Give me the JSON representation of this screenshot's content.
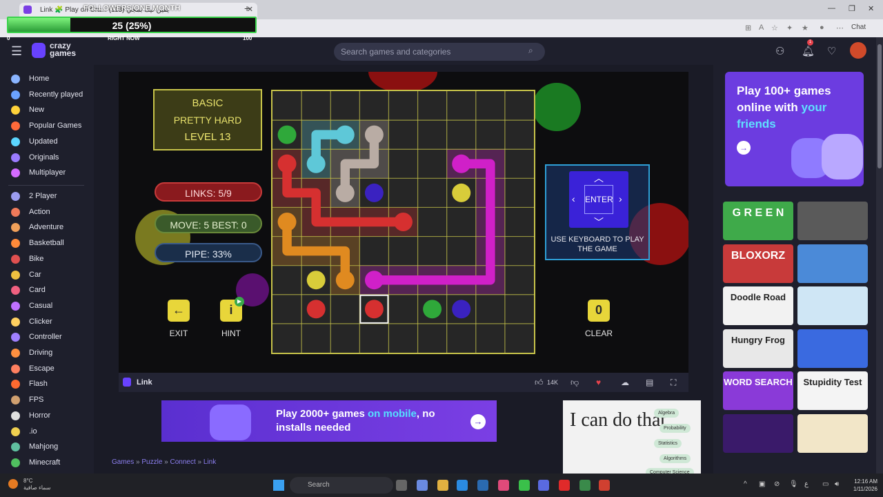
{
  "browser": {
    "tab_title": "Link 🧩 Play on Cra... (113) يقين ليك بمجي",
    "new_tab": "+",
    "chat_label": "Chat"
  },
  "overlay": {
    "title": "FOLLOWERS/ONE MONTH",
    "progress_text": "25 (25%)",
    "progress_fraction": 0.25,
    "min_label": "0",
    "mid_label": "RIGHT NOW",
    "max_label": "100"
  },
  "header": {
    "logo_text": "crazy games",
    "search_placeholder": "Search games and categories",
    "notification_count": "1"
  },
  "sidebar": {
    "primary": [
      {
        "label": "Home",
        "color": "#8ab4ff"
      },
      {
        "label": "Recently played",
        "color": "#6aa2ff"
      },
      {
        "label": "New",
        "color": "#ffd23a"
      },
      {
        "label": "Popular Games",
        "color": "#ff6a3a"
      },
      {
        "label": "Updated",
        "color": "#5bd6ff"
      },
      {
        "label": "Originals",
        "color": "#9b7bff"
      },
      {
        "label": "Multiplayer",
        "color": "#d46bff"
      }
    ],
    "categories": [
      {
        "label": "2 Player",
        "color": "#9b9cf0"
      },
      {
        "label": "Action",
        "color": "#f07a5a"
      },
      {
        "label": "Adventure",
        "color": "#f0a05a"
      },
      {
        "label": "Basketball",
        "color": "#ff8a3a"
      },
      {
        "label": "Bike",
        "color": "#e05050"
      },
      {
        "label": "Car",
        "color": "#f0c040"
      },
      {
        "label": "Card",
        "color": "#f06080"
      },
      {
        "label": "Casual",
        "color": "#c070ff"
      },
      {
        "label": "Clicker",
        "color": "#ffd060"
      },
      {
        "label": "Controller",
        "color": "#a080ff"
      },
      {
        "label": "Driving",
        "color": "#ff9040"
      },
      {
        "label": "Escape",
        "color": "#ff8060"
      },
      {
        "label": "Flash",
        "color": "#ff6a30"
      },
      {
        "label": "FPS",
        "color": "#d0a070"
      },
      {
        "label": "Horror",
        "color": "#e0e0e0"
      },
      {
        "label": ".io",
        "color": "#f0d050"
      },
      {
        "label": "Mahjong",
        "color": "#60c0a0"
      },
      {
        "label": "Minecraft",
        "color": "#50c060"
      }
    ]
  },
  "game": {
    "difficulty": "BASIC",
    "mode": "PRETTY HARD",
    "level": "LEVEL  13",
    "links": "LINKS:  5/9",
    "moves": "MOVE: 5    BEST: 0",
    "pipe": "PIPE:  33%",
    "exit_label": "EXIT",
    "hint_label": "HINT",
    "clear_label": "CLEAR",
    "clear_count": "0",
    "enter_label": "ENTER",
    "keyboard_text": "USE KEYBOARD TO PLAY THE GAME",
    "grid_size": 9,
    "colors": {
      "red": "#d63030",
      "green": "#2fa83a",
      "cyan": "#5ec8d8",
      "gray": "#b9aca4",
      "blue": "#3a22c0",
      "yellow": "#d8cc3a",
      "magenta": "#d020c8",
      "orange": "#e08a20",
      "grid_line": "#c8c44a"
    },
    "dots": [
      {
        "color": "green",
        "col": 0,
        "row": 1
      },
      {
        "color": "cyan",
        "col": 2,
        "row": 1
      },
      {
        "color": "gray",
        "col": 3,
        "row": 1
      },
      {
        "color": "red",
        "col": 0,
        "row": 2
      },
      {
        "color": "cyan",
        "col": 1,
        "row": 2
      },
      {
        "color": "magenta",
        "col": 6,
        "row": 2
      },
      {
        "color": "gray",
        "col": 2,
        "row": 3
      },
      {
        "color": "blue",
        "col": 3,
        "row": 3
      },
      {
        "color": "yellow",
        "col": 6,
        "row": 3
      },
      {
        "color": "red",
        "col": 4,
        "row": 4
      },
      {
        "color": "orange",
        "col": 0,
        "row": 4
      },
      {
        "color": "yellow",
        "col": 1,
        "row": 6
      },
      {
        "color": "orange",
        "col": 2,
        "row": 6
      },
      {
        "color": "magenta",
        "col": 3,
        "row": 6
      },
      {
        "color": "red",
        "col": 1,
        "row": 7
      },
      {
        "color": "red",
        "col": 3,
        "row": 7
      },
      {
        "color": "green",
        "col": 5,
        "row": 7
      },
      {
        "color": "blue",
        "col": 6,
        "row": 7
      }
    ],
    "paths": [
      {
        "color": "cyan",
        "cells": [
          [
            1,
            2
          ],
          [
            1,
            1
          ],
          [
            2,
            1
          ]
        ]
      },
      {
        "color": "gray",
        "cells": [
          [
            3,
            1
          ],
          [
            3,
            2
          ],
          [
            2,
            2
          ],
          [
            2,
            3
          ]
        ]
      },
      {
        "color": "red",
        "cells": [
          [
            0,
            2
          ],
          [
            0,
            3
          ],
          [
            1,
            3
          ],
          [
            1,
            4
          ],
          [
            2,
            4
          ],
          [
            3,
            4
          ],
          [
            4,
            4
          ]
        ]
      },
      {
        "color": "orange",
        "cells": [
          [
            0,
            4
          ],
          [
            0,
            5
          ],
          [
            1,
            5
          ],
          [
            2,
            5
          ],
          [
            2,
            6
          ]
        ]
      },
      {
        "color": "magenta",
        "cells": [
          [
            6,
            2
          ],
          [
            7,
            2
          ],
          [
            7,
            3
          ],
          [
            7,
            4
          ],
          [
            7,
            5
          ],
          [
            7,
            6
          ],
          [
            6,
            6
          ],
          [
            5,
            6
          ],
          [
            4,
            6
          ],
          [
            3,
            6
          ]
        ]
      }
    ],
    "selected_cell": {
      "col": 3,
      "row": 7
    }
  },
  "gamebar": {
    "title": "Link",
    "likes": "14K"
  },
  "banner": {
    "text_pre": "Play 2000+ games ",
    "text_highlight": "on mobile",
    "text_post": ", no installs needed"
  },
  "ad": {
    "text": "I can do that",
    "chips": [
      "Algebra",
      "Probability",
      "Statistics",
      "Algorithms",
      "Computer Science"
    ]
  },
  "breadcrumb": [
    "Games",
    "Puzzle",
    "Connect",
    "Link"
  ],
  "promo": {
    "line1": "Play 100+ games online with ",
    "highlight": "your friends"
  },
  "thumbnails": [
    {
      "label": "G R E E N",
      "bg": "#3faa4a",
      "fg": "#ffffff"
    },
    {
      "label": "",
      "bg": "#5a5a5a",
      "fg": "#ffffff"
    },
    {
      "label": "BLOXORZ",
      "bg": "#c83a3a",
      "fg": "#ffffff"
    },
    {
      "label": "",
      "bg": "#4b8ad8",
      "fg": "#ffffff"
    },
    {
      "label": "Doodle Road",
      "bg": "#f2f2f2",
      "fg": "#222222"
    },
    {
      "label": "",
      "bg": "#cfe6f5",
      "fg": "#222222"
    },
    {
      "label": "Hungry Frog",
      "bg": "#e8e8e8",
      "fg": "#222222"
    },
    {
      "label": "",
      "bg": "#3a6ae0",
      "fg": "#ffffff"
    },
    {
      "label": "WORD SEARCH",
      "bg": "#8a3ad8",
      "fg": "#ffffff"
    },
    {
      "label": "Stupidity Test",
      "bg": "#f4f4f4",
      "fg": "#222222"
    },
    {
      "label": "",
      "bg": "#3a1a6a",
      "fg": "#ffffff"
    },
    {
      "label": "",
      "bg": "#f2e6c8",
      "fg": "#222222"
    }
  ],
  "taskbar": {
    "temperature": "8°C",
    "weather_text": "سماء صافية",
    "search_label": "Search",
    "time": "12:16 AM",
    "date": "1/11/2026"
  }
}
